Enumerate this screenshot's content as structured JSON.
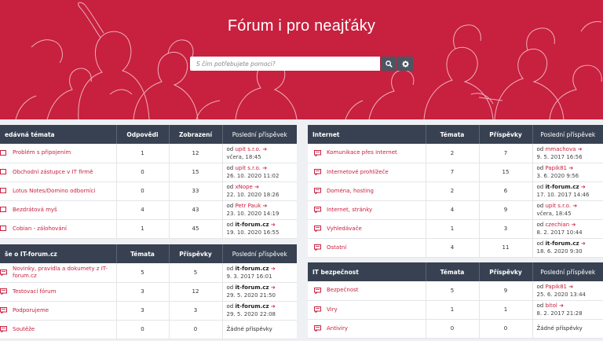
{
  "hero": {
    "title": "Fórum i pro neajťáky",
    "search_placeholder": "S čím potřebujete pomoci?",
    "bg_color": "#c8203f",
    "search_icon": "search-icon",
    "settings_icon": "gear-icon"
  },
  "arrow": "➔",
  "panels": {
    "recent": {
      "headers": [
        "edávná témata",
        "Odpovědi",
        "Zobrazení",
        "Poslední příspěvek"
      ],
      "rows": [
        {
          "name": "Problém s připojením",
          "a": "1",
          "b": "12",
          "by_prefix": "od ",
          "by": "upit s.r.o.",
          "date": "včera, 18:45"
        },
        {
          "name": "Obchodní zástupce v IT firmě",
          "a": "0",
          "b": "15",
          "by_prefix": "od ",
          "by": "upit s.r.o.",
          "date": "26. 10. 2020 11:02"
        },
        {
          "name": "Lotus Notes/Domino odborníci",
          "a": "0",
          "b": "33",
          "by_prefix": "od ",
          "by": "xNope",
          "date": "22. 10. 2020 18:26"
        },
        {
          "name": "Bezdrátová myš",
          "a": "4",
          "b": "43",
          "by_prefix": "od ",
          "by": "Petr Pauk",
          "date": "23. 10. 2020 14:19"
        },
        {
          "name": "Cobian - zálohování",
          "a": "1",
          "b": "45",
          "by_prefix": "od ",
          "by": "it-forum.cz",
          "date": "19. 10. 2020 16:55"
        }
      ]
    },
    "about": {
      "headers": [
        "še o IT-forum.cz",
        "Témata",
        "Příspěvky",
        "Poslední příspěvek"
      ],
      "rows": [
        {
          "name": "Novinky, pravidla a dokumety z IT-forum.cz",
          "a": "5",
          "b": "5",
          "by_prefix": "od ",
          "by": "it-forum.cz",
          "date": "9. 3. 2017 16:01"
        },
        {
          "name": "Testovací fórum",
          "a": "3",
          "b": "12",
          "by_prefix": "od ",
          "by": "it-forum.cz",
          "date": "29. 5. 2020 21:50"
        },
        {
          "name": "Podporujeme",
          "a": "3",
          "b": "3",
          "by_prefix": "od ",
          "by": "it-forum.cz",
          "date": "29. 5. 2020 22:08"
        },
        {
          "name": "Soutěže",
          "a": "0",
          "b": "0",
          "by_prefix": "",
          "by": "",
          "date": "Žádné příspěvky"
        }
      ]
    },
    "internet": {
      "headers": [
        "Internet",
        "Témata",
        "Příspěvky",
        "Poslední příspěvek"
      ],
      "rows": [
        {
          "name": "Komunikace přes internet",
          "a": "2",
          "b": "7",
          "by_prefix": "od ",
          "by": "mmachova",
          "date": "9. 5. 2017 16:56"
        },
        {
          "name": "Internetové prohlížeče",
          "a": "7",
          "b": "15",
          "by_prefix": "od ",
          "by": "Papik81",
          "date": "3. 6. 2020 9:56"
        },
        {
          "name": "Doména, hosting",
          "a": "2",
          "b": "6",
          "by_prefix": "od ",
          "by": "it-forum.cz",
          "date": "17. 10. 2017 14:46"
        },
        {
          "name": "Internet, stránky",
          "a": "4",
          "b": "9",
          "by_prefix": "od ",
          "by": "upit s.r.o.",
          "date": "včera, 18:45"
        },
        {
          "name": "Vyhledávače",
          "a": "1",
          "b": "3",
          "by_prefix": "od ",
          "by": "czechian",
          "date": "8. 2. 2017 10:44"
        },
        {
          "name": "Ostatní",
          "a": "4",
          "b": "11",
          "by_prefix": "od ",
          "by": "it-forum.cz",
          "date": "18. 6. 2020 9:30"
        }
      ]
    },
    "security": {
      "headers": [
        "IT bezpečnost",
        "Témata",
        "Příspěvky",
        "Poslední příspěvek"
      ],
      "rows": [
        {
          "name": "Bezpečnost",
          "a": "5",
          "b": "9",
          "by_prefix": "od ",
          "by": "Papik81",
          "date": "25. 6. 2020 13:44"
        },
        {
          "name": "Viry",
          "a": "1",
          "b": "1",
          "by_prefix": "od ",
          "by": "bitol",
          "date": "8. 2. 2017 21:28"
        },
        {
          "name": "Antiviry",
          "a": "0",
          "b": "0",
          "by_prefix": "",
          "by": "",
          "date": "Žádné příspěvky"
        }
      ]
    }
  }
}
